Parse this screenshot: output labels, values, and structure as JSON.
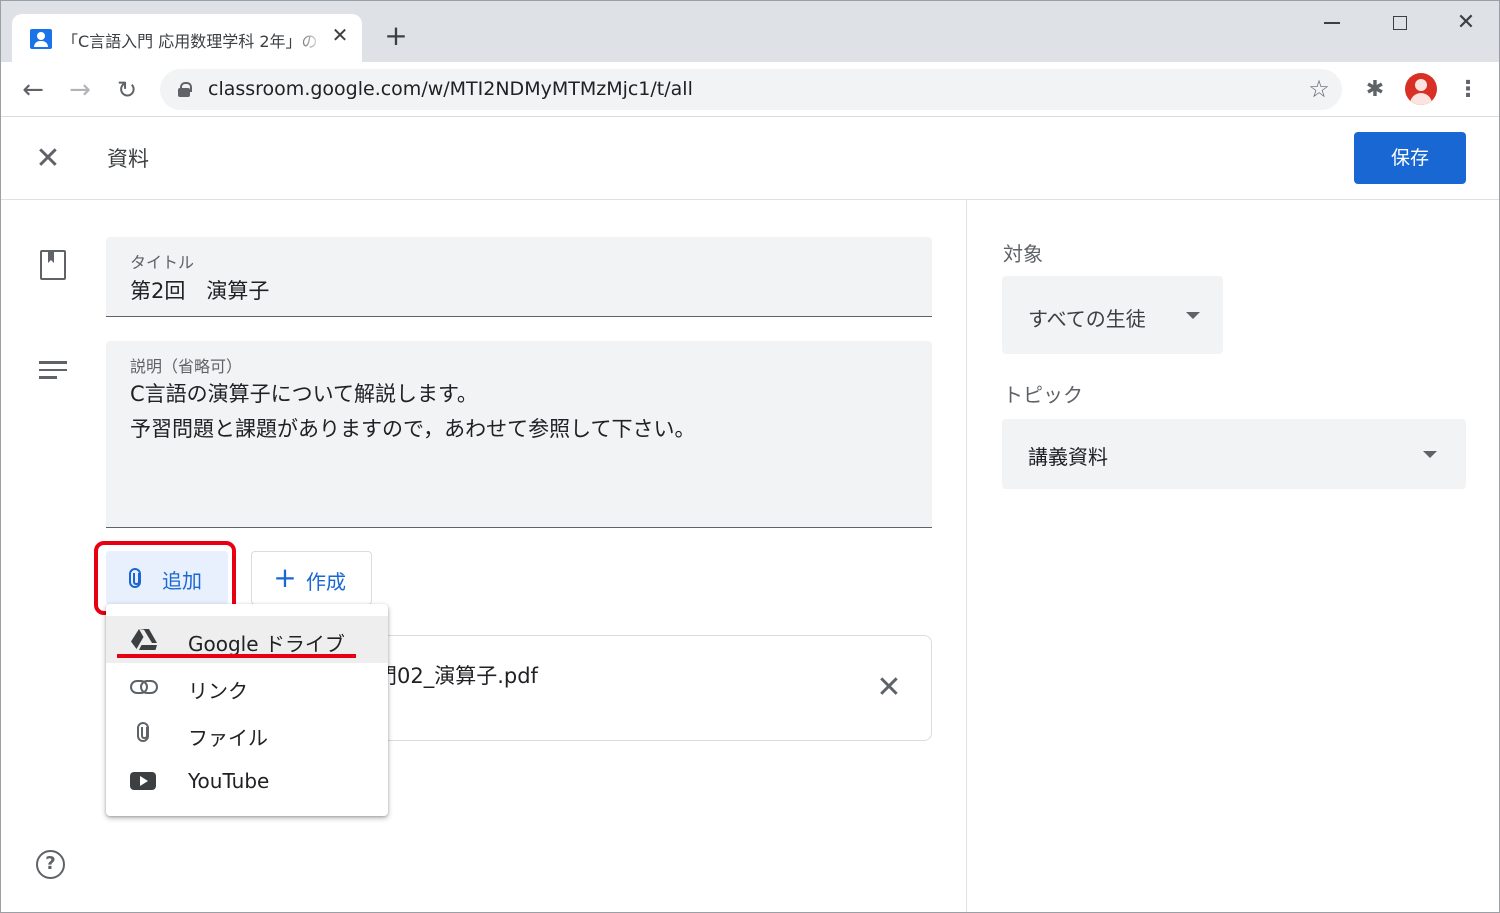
{
  "browser": {
    "tab_title": "「C言語入門 応用数理学科 2年」の",
    "url": "classroom.google.com/w/MTI2NDMyMTMzMjc1/t/all"
  },
  "header": {
    "title": "資料",
    "save_label": "保存"
  },
  "form": {
    "title_label": "タイトル",
    "title_value": "第2回　演算子",
    "description_label": "説明（省略可）",
    "description_lines": [
      "C言語の演算子について解説します。",
      "予習問題と課題がありますので，あわせて参照して下さい。"
    ],
    "add_label": "追加",
    "create_label": "作成",
    "attachment_name_visible": "門02_演算子.pdf"
  },
  "add_menu": {
    "items": [
      {
        "label": "Google ドライブ",
        "icon": "google-drive-icon",
        "active": true
      },
      {
        "label": "リンク",
        "icon": "link-icon",
        "active": false
      },
      {
        "label": "ファイル",
        "icon": "paperclip-icon",
        "active": false
      },
      {
        "label": "YouTube",
        "icon": "youtube-icon",
        "active": false
      }
    ]
  },
  "sidebar": {
    "target_label": "対象",
    "target_value": "すべての生徒",
    "topic_label": "トピック",
    "topic_value": "講義資料"
  },
  "colors": {
    "primary": "#1967d2",
    "highlight_red": "#e60012",
    "field_bg": "#f1f3f4"
  }
}
